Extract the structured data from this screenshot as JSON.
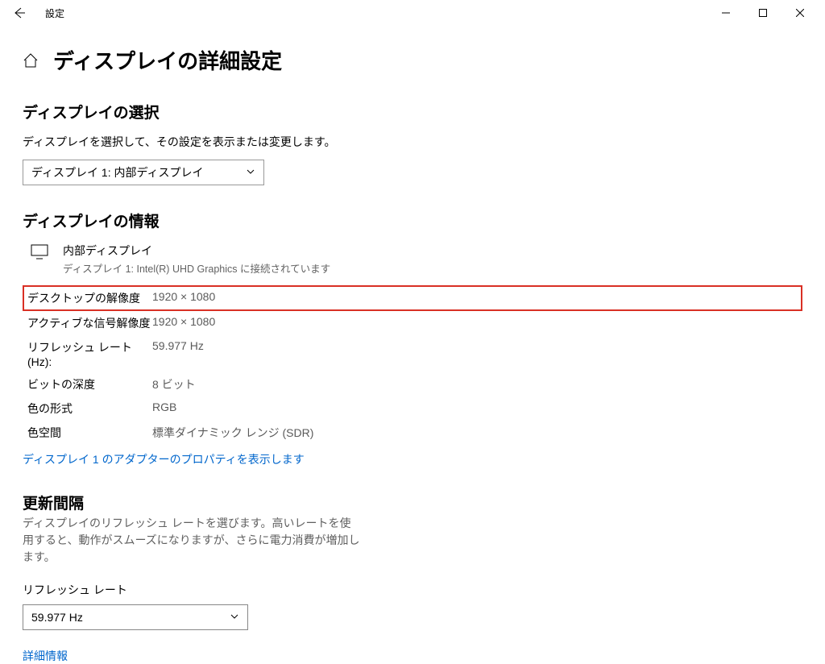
{
  "titlebar": {
    "title": "設定"
  },
  "page": {
    "title": "ディスプレイの詳細設定"
  },
  "select_display": {
    "heading": "ディスプレイの選択",
    "desc": "ディスプレイを選択して、その設定を表示または変更します。",
    "dropdown_value": "ディスプレイ 1: 内部ディスプレイ"
  },
  "display_info": {
    "heading": "ディスプレイの情報",
    "name": "内部ディスプレイ",
    "sub": "ディスプレイ 1: Intel(R) UHD Graphics に接続されています",
    "rows": {
      "desktop_res_label": "デスクトップの解像度",
      "desktop_res_value": "1920 × 1080",
      "active_res_label": "アクティブな信号解像度",
      "active_res_value": "1920 × 1080",
      "refresh_label": "リフレッシュ レート (Hz):",
      "refresh_value": "59.977 Hz",
      "bit_label": "ビットの深度",
      "bit_value": "8 ビット",
      "color_label": "色の形式",
      "color_value": "RGB",
      "space_label": "色空間",
      "space_value": "標準ダイナミック レンジ (SDR)"
    },
    "adapter_link": "ディスプレイ 1 のアダプターのプロパティを表示します"
  },
  "refresh": {
    "heading": "更新間隔",
    "desc": "ディスプレイのリフレッシュ レートを選びます。高いレートを使用すると、動作がスムーズになりますが、さらに電力消費が増加します。",
    "field_label": "リフレッシュ レート",
    "dropdown_value": "59.977 Hz",
    "detail_link": "詳細情報"
  }
}
